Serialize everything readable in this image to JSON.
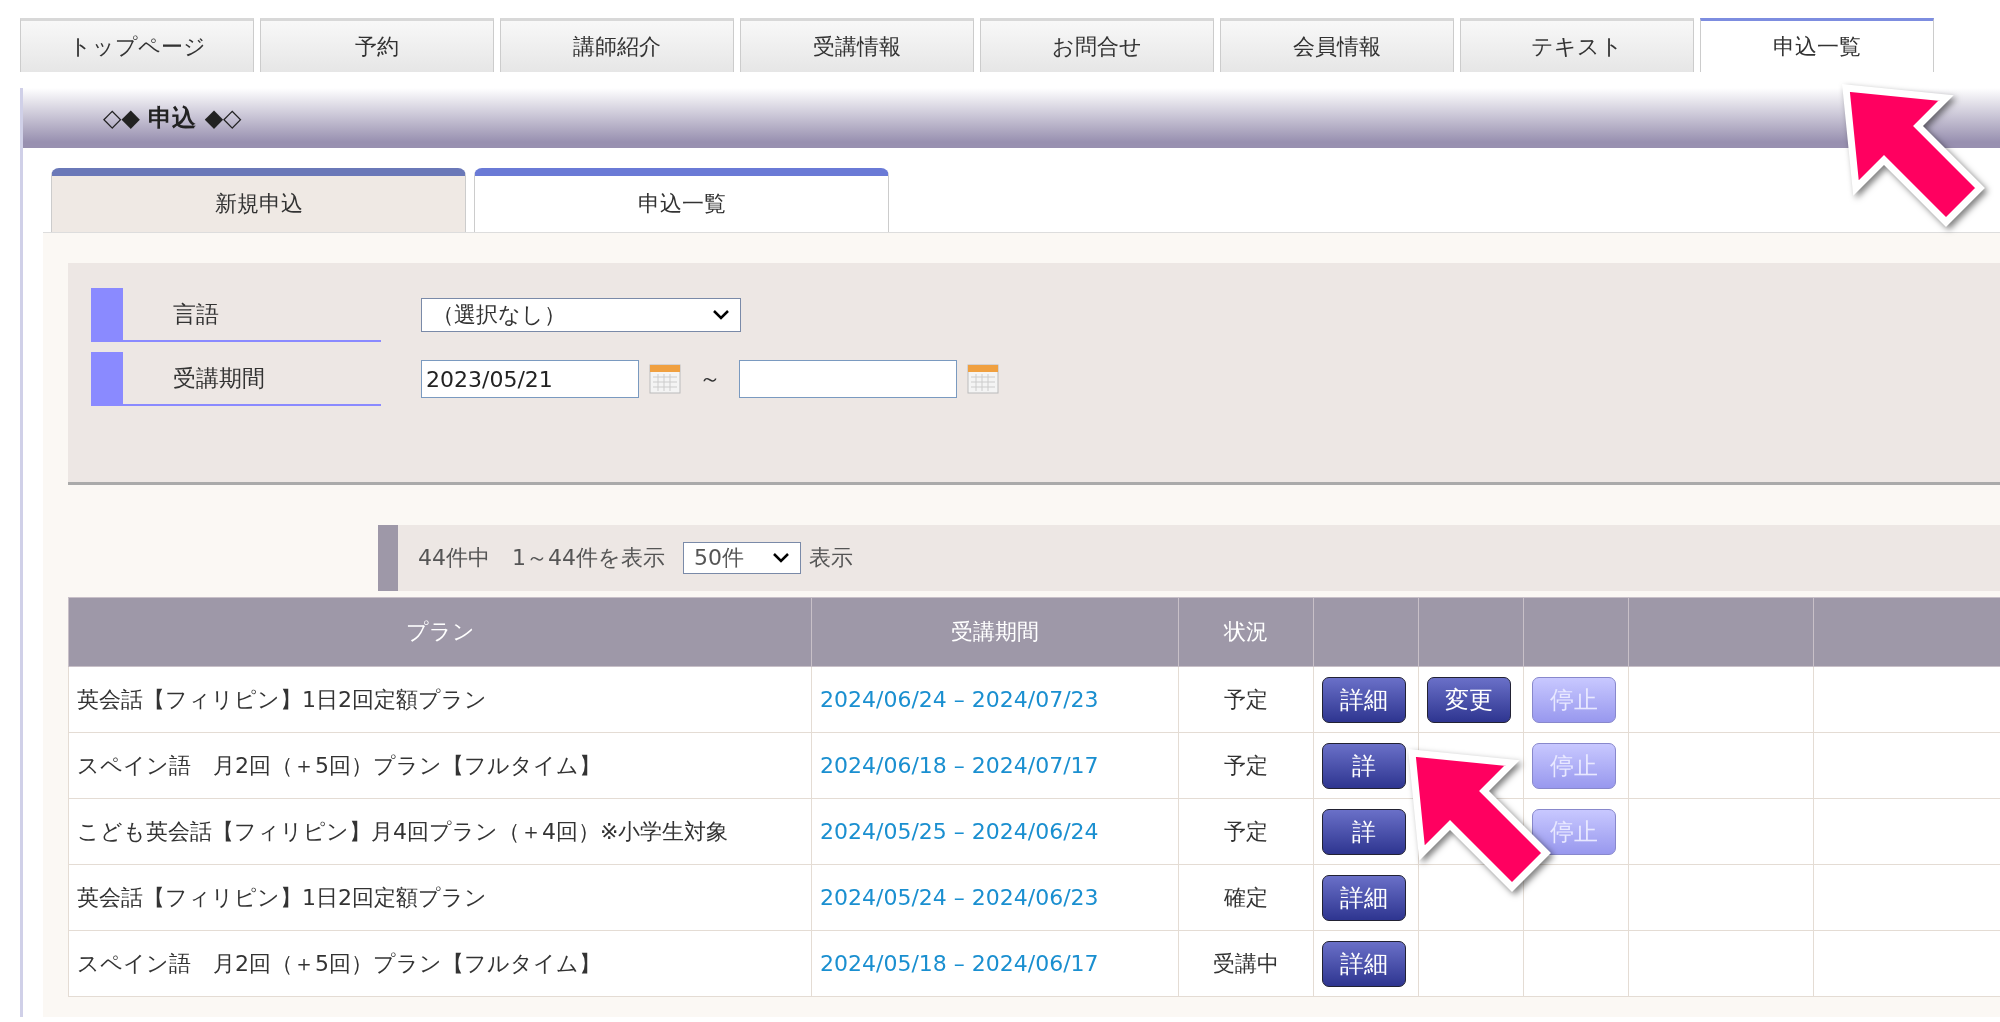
{
  "nav_tabs": [
    {
      "label": "トップページ",
      "selected": false
    },
    {
      "label": "予約",
      "selected": false
    },
    {
      "label": "講師紹介",
      "selected": false
    },
    {
      "label": "受講情報",
      "selected": false
    },
    {
      "label": "お問合せ",
      "selected": false
    },
    {
      "label": "会員情報",
      "selected": false
    },
    {
      "label": "テキスト",
      "selected": false
    },
    {
      "label": "申込一覧",
      "selected": true
    }
  ],
  "section_title": "◇◆ 申込 ◆◇",
  "sub_tabs": [
    {
      "label": "新規申込",
      "selected": false
    },
    {
      "label": "申込一覧",
      "selected": true
    }
  ],
  "filters": {
    "language": {
      "label": "言語",
      "value": "（選択なし）"
    },
    "period": {
      "label": "受講期間",
      "from": "2023/05/21",
      "separator": "～"
    }
  },
  "pager": {
    "summary": "44件中　1～44件を表示",
    "page_size": "50件",
    "suffix": "表示"
  },
  "table": {
    "columns": [
      "プラン",
      "受講期間",
      "状況"
    ],
    "rows": [
      {
        "plan": "英会話【フィリピン】1日2回定額プラン",
        "period": "2024/06/24 – 2024/07/23",
        "status": "予定",
        "detail": {
          "label": "詳細"
        },
        "change": {
          "label": "変更"
        },
        "stop": {
          "label": "停止",
          "disabled": true
        }
      },
      {
        "plan": "スペイン語　月2回（＋5回）プラン【フルタイム】",
        "period": "2024/06/18 – 2024/07/17",
        "status": "予定",
        "detail": {
          "label": "詳"
        },
        "stop": {
          "label": "停止",
          "disabled": true
        }
      },
      {
        "plan": "こども英会話【フィリピン】月4回プラン（＋4回）※小学生対象",
        "period": "2024/05/25 – 2024/06/24",
        "status": "予定",
        "detail": {
          "label": "詳"
        },
        "stop": {
          "label": "停止",
          "disabled": true
        }
      },
      {
        "plan": "英会話【フィリピン】1日2回定額プラン",
        "period": "2024/05/24 – 2024/06/23",
        "status": "確定",
        "detail": {
          "label": "詳細"
        }
      },
      {
        "plan": "スペイン語　月2回（＋5回）プラン【フルタイム】",
        "period": "2024/05/18 – 2024/06/17",
        "status": "受講中",
        "detail": {
          "label": "詳細"
        }
      }
    ]
  }
}
